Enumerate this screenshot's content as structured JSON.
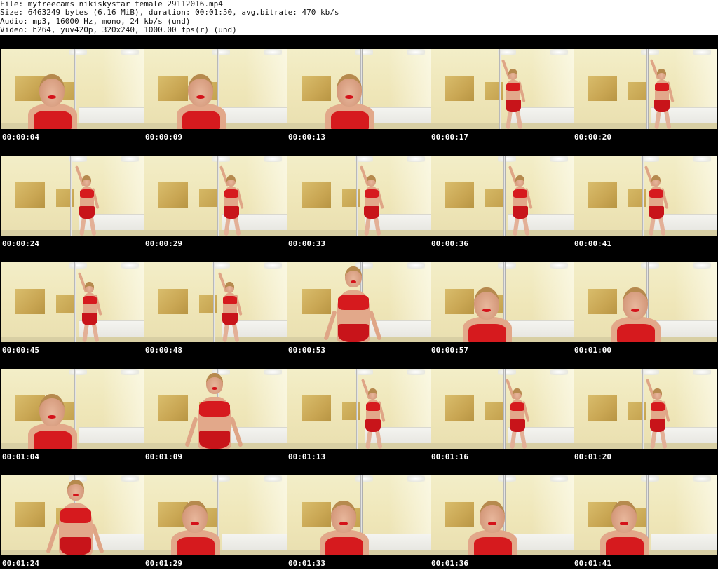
{
  "header": {
    "file_line": "File: myfreecams_nikiskystar_female_29112016.mp4",
    "size_line": "Size: 6463249 bytes (6.16 MiB), duration: 00:01:50, avg.bitrate: 470 kb/s",
    "audio_line": "Audio: mp3, 16000 Hz, mono, 24 kb/s (und)",
    "video_line": "Video: h264, yuv420p, 320x240, 1000.00 fps(r) (und)"
  },
  "colors": {
    "sheet_background": "#000000",
    "timestamp_text": "#ffffff",
    "outfit_red": "#d61a1e",
    "wall_cream": "#f3eec8"
  },
  "thumbnails": [
    {
      "timestamp": "00:00:04",
      "pose": "closeup"
    },
    {
      "timestamp": "00:00:09",
      "pose": "closeup"
    },
    {
      "timestamp": "00:00:13",
      "pose": "closeup"
    },
    {
      "timestamp": "00:00:17",
      "pose": "standing"
    },
    {
      "timestamp": "00:00:20",
      "pose": "standing"
    },
    {
      "timestamp": "00:00:24",
      "pose": "standing"
    },
    {
      "timestamp": "00:00:29",
      "pose": "standing"
    },
    {
      "timestamp": "00:00:33",
      "pose": "standing"
    },
    {
      "timestamp": "00:00:36",
      "pose": "standing"
    },
    {
      "timestamp": "00:00:41",
      "pose": "standing"
    },
    {
      "timestamp": "00:00:45",
      "pose": "standing"
    },
    {
      "timestamp": "00:00:48",
      "pose": "standing"
    },
    {
      "timestamp": "00:00:53",
      "pose": "mid"
    },
    {
      "timestamp": "00:00:57",
      "pose": "closeup"
    },
    {
      "timestamp": "00:01:00",
      "pose": "closeup"
    },
    {
      "timestamp": "00:01:04",
      "pose": "closeup"
    },
    {
      "timestamp": "00:01:09",
      "pose": "mid"
    },
    {
      "timestamp": "00:01:13",
      "pose": "standing"
    },
    {
      "timestamp": "00:01:16",
      "pose": "standing"
    },
    {
      "timestamp": "00:01:20",
      "pose": "standing"
    },
    {
      "timestamp": "00:01:24",
      "pose": "mid"
    },
    {
      "timestamp": "00:01:29",
      "pose": "closeup"
    },
    {
      "timestamp": "00:01:33",
      "pose": "closeup"
    },
    {
      "timestamp": "00:01:36",
      "pose": "closeup"
    },
    {
      "timestamp": "00:01:41",
      "pose": "closeup"
    }
  ]
}
